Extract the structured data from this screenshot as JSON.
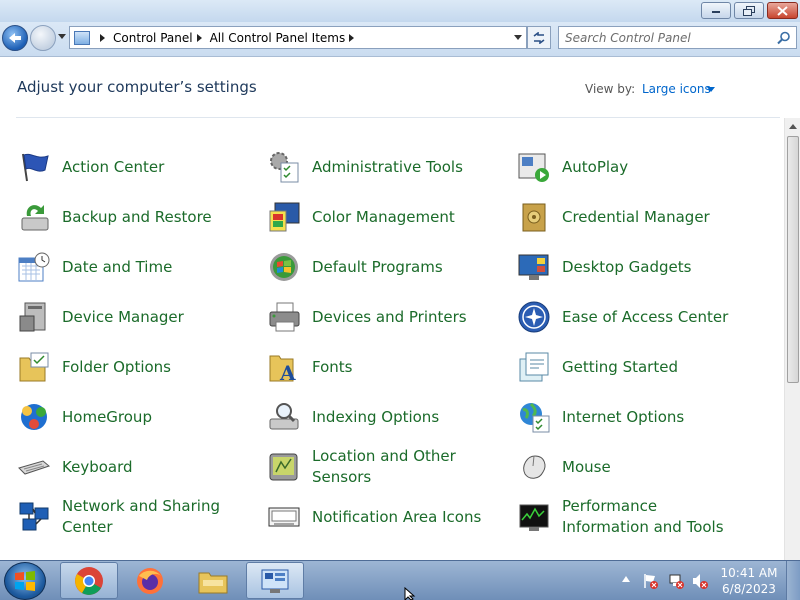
{
  "window": {
    "buttons": {
      "minimize": "minimize",
      "maximize": "maximize",
      "close": "close"
    }
  },
  "address": {
    "breadcrumb": [
      "Control Panel",
      "All Control Panel Items"
    ],
    "search_placeholder": "Search Control Panel"
  },
  "header": {
    "title": "Adjust your computer’s settings",
    "view_by_label": "View by:",
    "view_by_value": "Large icons"
  },
  "items": [
    {
      "label": "Action Center",
      "icon": "action-center-flag-icon"
    },
    {
      "label": "Administrative Tools",
      "icon": "administrative-tools-icon"
    },
    {
      "label": "AutoPlay",
      "icon": "autoplay-icon"
    },
    {
      "label": "Backup and Restore",
      "icon": "backup-restore-icon"
    },
    {
      "label": "Color Management",
      "icon": "color-management-icon"
    },
    {
      "label": "Credential Manager",
      "icon": "credential-manager-vault-icon"
    },
    {
      "label": "Date and Time",
      "icon": "date-time-calendar-icon"
    },
    {
      "label": "Default Programs",
      "icon": "default-programs-icon"
    },
    {
      "label": "Desktop Gadgets",
      "icon": "desktop-gadgets-icon"
    },
    {
      "label": "Device Manager",
      "icon": "device-manager-icon"
    },
    {
      "label": "Devices and Printers",
      "icon": "printer-icon"
    },
    {
      "label": "Ease of Access Center",
      "icon": "ease-of-access-icon"
    },
    {
      "label": "Folder Options",
      "icon": "folder-options-icon"
    },
    {
      "label": "Fonts",
      "icon": "fonts-folder-icon"
    },
    {
      "label": "Getting Started",
      "icon": "getting-started-icon"
    },
    {
      "label": "HomeGroup",
      "icon": "homegroup-icon"
    },
    {
      "label": "Indexing Options",
      "icon": "indexing-options-icon"
    },
    {
      "label": "Internet Options",
      "icon": "internet-options-globe-icon"
    },
    {
      "label": "Keyboard",
      "icon": "keyboard-icon"
    },
    {
      "label": "Location and Other Sensors",
      "icon": "location-sensors-icon"
    },
    {
      "label": "Mouse",
      "icon": "mouse-icon"
    },
    {
      "label": "Network and Sharing Center",
      "icon": "network-sharing-icon"
    },
    {
      "label": "Notification Area Icons",
      "icon": "notification-area-icon"
    },
    {
      "label": "Performance Information and Tools",
      "icon": "performance-tools-icon"
    }
  ],
  "taskbar": {
    "apps": [
      "Google Chrome",
      "Mozilla Firefox",
      "Windows Explorer",
      "Control Panel"
    ],
    "time": "10:41 AM",
    "date": "6/8/2023"
  },
  "colors": {
    "link_green": "#1b6b2a",
    "title_blue": "#1e395b",
    "accent_blue": "#0066cc"
  }
}
